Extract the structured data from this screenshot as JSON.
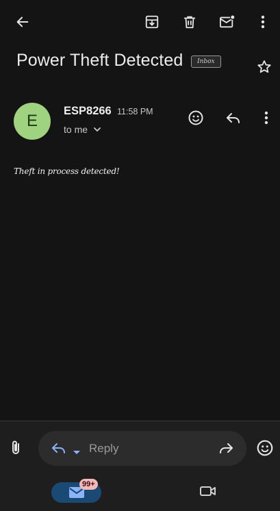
{
  "toolbar": {
    "back_icon": "arrow-back-icon",
    "archive_icon": "archive-icon",
    "delete_icon": "trash-icon",
    "mark_unread_icon": "mail-unread-icon",
    "more_icon": "more-vert-icon"
  },
  "email": {
    "subject": "Power Theft Detected",
    "label": "Inbox",
    "starred": false,
    "sender": {
      "initial": "E",
      "name": "ESP8266",
      "time": "11:58 PM",
      "recipient": "to me",
      "avatar_color": "#9fd37f"
    },
    "body": "Theft in process detected!"
  },
  "compose": {
    "reply_placeholder": "Reply",
    "reply_icon": "reply-icon",
    "forward_icon": "forward-icon",
    "attach_icon": "attachment-icon",
    "emoji_icon": "emoji-icon"
  },
  "bottom_nav": {
    "mail_badge": "99+",
    "mail_icon": "mail-icon",
    "video_icon": "video-camera-icon",
    "accent": "#1a4a73"
  }
}
